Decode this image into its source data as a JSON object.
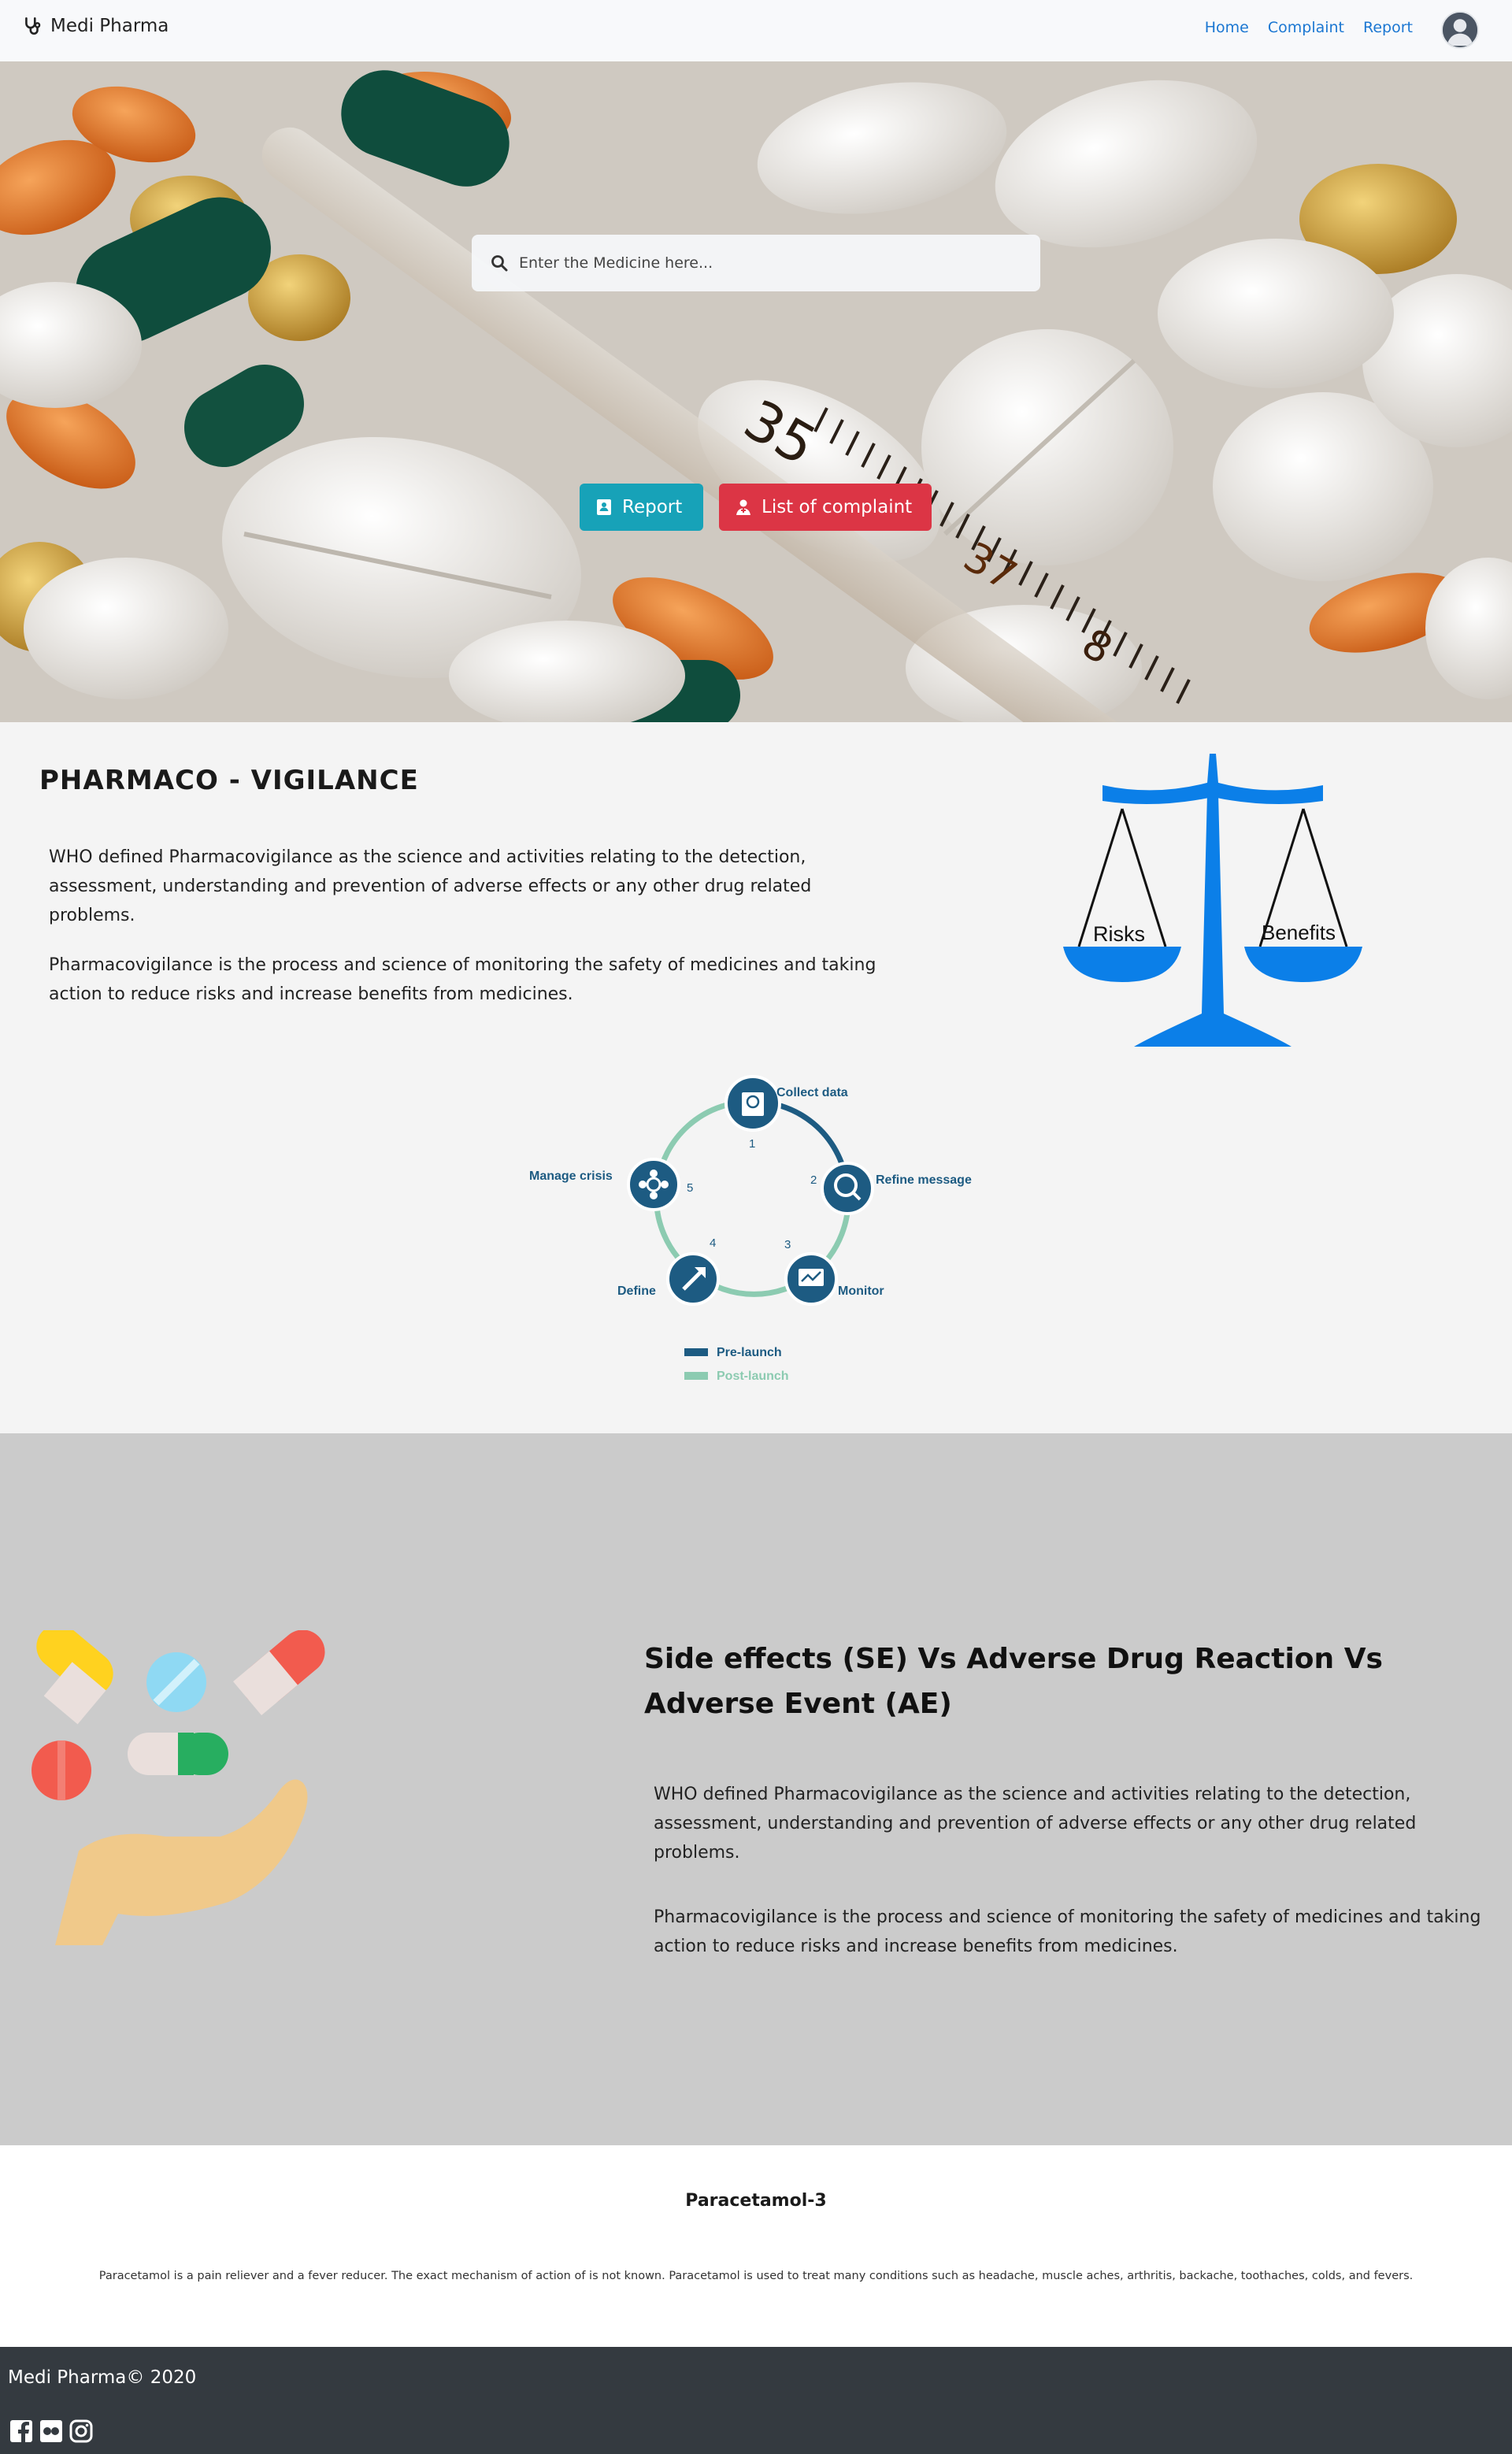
{
  "navbar": {
    "brand": "Medi Pharma",
    "links": [
      "Home",
      "Complaint",
      "Report"
    ]
  },
  "hero": {
    "search_placeholder": "Enter the Medicine here...",
    "report_label": "Report",
    "complaint_label": "List of complaint"
  },
  "pharmacovigilance": {
    "title": "PHARMACO - VIGILANCE",
    "para1": "WHO defined Pharmacovigilance as the science and activities relating to the detection, assessment, understanding and prevention of adverse effects or any other drug related problems.",
    "para2": "Pharmacovigilance is the process and science of monitoring the safety of medicines and taking action to reduce risks and increase benefits from medicines.",
    "scale_left": "Risks",
    "scale_right": "Benefits",
    "cycle": {
      "steps": [
        {
          "num": "1",
          "label": "Collect data"
        },
        {
          "num": "2",
          "label": "Refine message"
        },
        {
          "num": "3",
          "label": "Monitor"
        },
        {
          "num": "4",
          "label": "Define"
        },
        {
          "num": "5",
          "label": "Manage crisis"
        }
      ],
      "legend": [
        "Pre-launch",
        "Post-launch"
      ]
    }
  },
  "side_effects": {
    "title": "Side effects (SE) Vs Adverse Drug Reaction Vs Adverse Event (AE)",
    "para1": "WHO defined Pharmacovigilance as the science and activities relating to the detection, assessment, understanding and prevention of adverse effects or any other drug related problems.",
    "para2": "Pharmacovigilance is the process and science of monitoring the safety of medicines and taking action to reduce risks and increase benefits from medicines."
  },
  "medicine": {
    "title": "Paracetamol-3",
    "description": "Paracetamol is a pain reliever and a fever reducer. The exact mechanism of action of is not known. Paracetamol is used to treat many conditions such as headache, muscle aches, arthritis, backache, toothaches, colds, and fevers."
  },
  "footer": {
    "copyright": "Medi Pharma© 2020"
  },
  "colors": {
    "accent": "#1b77d2",
    "report_btn": "#17a2b8",
    "complaint_btn": "#dc3545",
    "footer_bg": "#343a40",
    "scale_blue": "#0b7fe8",
    "cycle_dark": "#1d5b82",
    "cycle_light": "#8ccbb1"
  }
}
